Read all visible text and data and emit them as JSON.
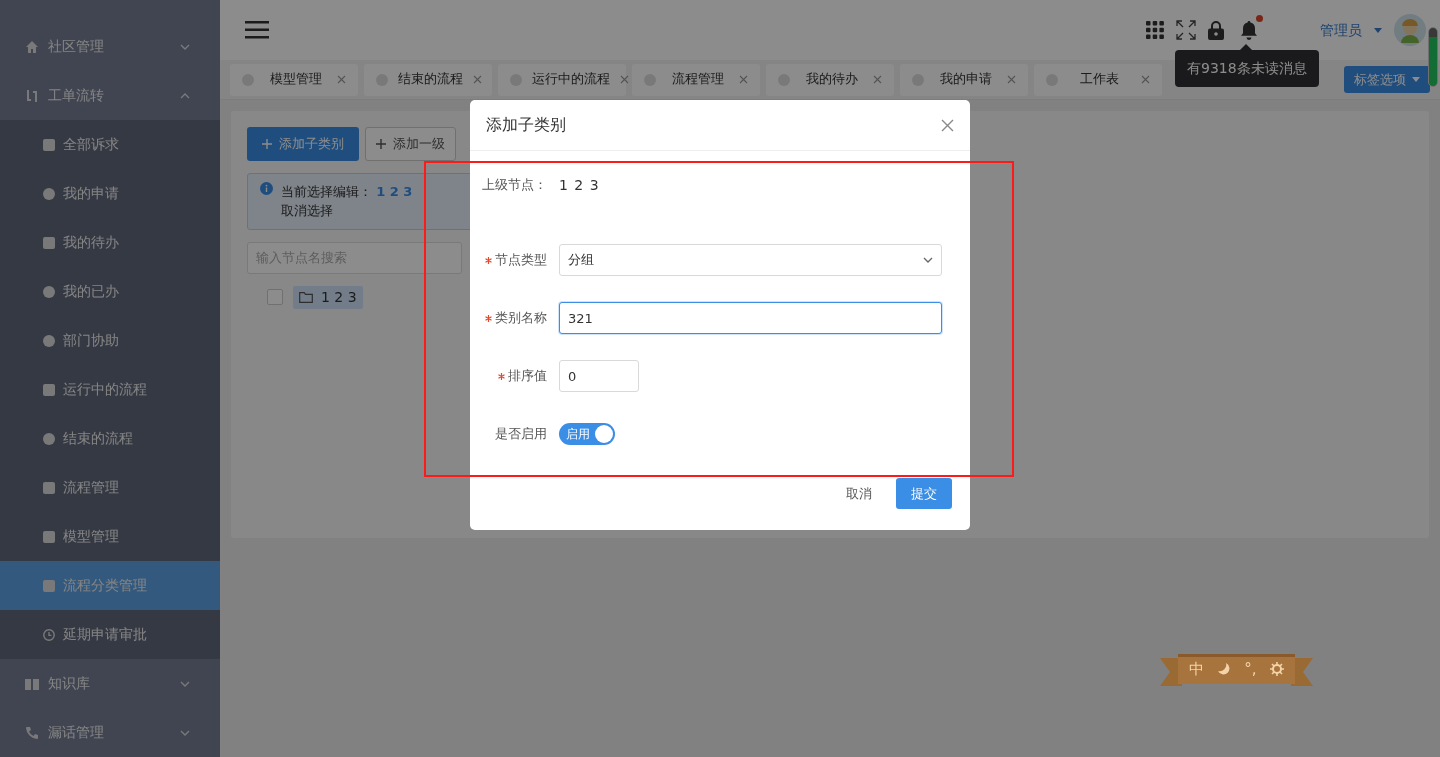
{
  "sidebar": {
    "items": [
      {
        "label": "社区管理",
        "expanded": false
      },
      {
        "label": "工单流转",
        "expanded": true,
        "children": [
          {
            "label": "全部诉求",
            "selected": false
          },
          {
            "label": "我的申请",
            "selected": false
          },
          {
            "label": "我的待办",
            "selected": false
          },
          {
            "label": "我的已办",
            "selected": false
          },
          {
            "label": "部门协助",
            "selected": false
          },
          {
            "label": "运行中的流程",
            "selected": false
          },
          {
            "label": "结束的流程",
            "selected": false
          },
          {
            "label": "流程管理",
            "selected": false
          },
          {
            "label": "模型管理",
            "selected": false
          },
          {
            "label": "流程分类管理",
            "selected": true
          },
          {
            "label": "延期申请审批",
            "selected": false
          }
        ]
      },
      {
        "label": "知识库",
        "expanded": false
      },
      {
        "label": "漏话管理",
        "expanded": false
      }
    ]
  },
  "header": {
    "user": "管理员",
    "unread": true,
    "tooltip": "有9318条未读消息"
  },
  "tabs": [
    {
      "label": "模型管理"
    },
    {
      "label": "结束的流程"
    },
    {
      "label": "运行中的流程"
    },
    {
      "label": "流程管理"
    },
    {
      "label": "我的待办"
    },
    {
      "label": "我的申请"
    },
    {
      "label": "工作表"
    }
  ],
  "tab_options": "标签选项",
  "content": {
    "buttons": [
      "添加子类别",
      "添加一级"
    ],
    "info": {
      "prefix": "当前选择编辑：",
      "node": "1 2 3",
      "action": "取消选择"
    },
    "search_placeholder": "输入节点名搜索",
    "tree": [
      {
        "label": "1 2 3",
        "checked": false,
        "selected": true
      }
    ]
  },
  "modal": {
    "title": "添加子类别",
    "fields": [
      {
        "kind": "static",
        "label": "上级节点：",
        "value": "1 2 3"
      },
      {
        "kind": "select",
        "label": "节点类型",
        "required": true,
        "value": "分组"
      },
      {
        "kind": "text",
        "label": "类别名称",
        "required": true,
        "value": "321"
      },
      {
        "kind": "number",
        "label": "排序值",
        "required": true,
        "value": "0"
      },
      {
        "kind": "switch",
        "label": "是否启用",
        "on": true,
        "text": "启用"
      }
    ],
    "buttons": [
      {
        "kind": "plain",
        "label": "取消"
      },
      {
        "kind": "primary",
        "label": "提交"
      }
    ]
  },
  "widget": [
    {
      "kind": "text",
      "text": "中"
    },
    {
      "kind": "moon"
    },
    {
      "kind": "text",
      "text": "°,"
    },
    {
      "kind": "gear"
    }
  ]
}
